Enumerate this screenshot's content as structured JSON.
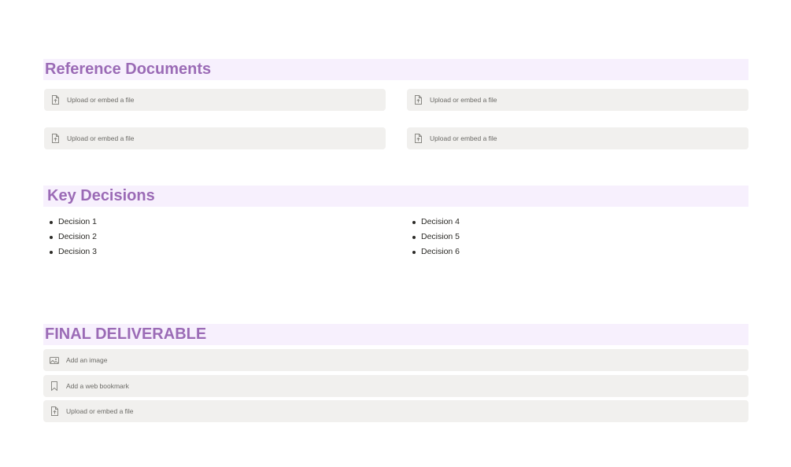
{
  "reference_documents": {
    "heading": "Reference Documents",
    "file_blocks": [
      {
        "label": "Upload or embed a file",
        "icon": "file-upload-icon"
      },
      {
        "label": "Upload or embed a file",
        "icon": "file-upload-icon"
      },
      {
        "label": "Upload or embed a file",
        "icon": "file-upload-icon"
      },
      {
        "label": "Upload or embed a file",
        "icon": "file-upload-icon"
      }
    ]
  },
  "key_decisions": {
    "heading": "Key Decisions",
    "left_column": [
      "Decision 1",
      "Decision 2",
      "Decision 3"
    ],
    "right_column": [
      "Decision 4",
      "Decision 5",
      "Decision 6"
    ]
  },
  "final_deliverable": {
    "heading": "FINAL DELIVERABLE",
    "blocks": [
      {
        "label": "Add an image",
        "icon": "image-icon"
      },
      {
        "label": "Add a web bookmark",
        "icon": "bookmark-icon"
      },
      {
        "label": "Upload or embed a file",
        "icon": "file-upload-icon"
      }
    ]
  },
  "colors": {
    "heading_text": "#9b6bb6",
    "heading_background": "#f7f0fd",
    "block_background": "#f1f0ee"
  }
}
